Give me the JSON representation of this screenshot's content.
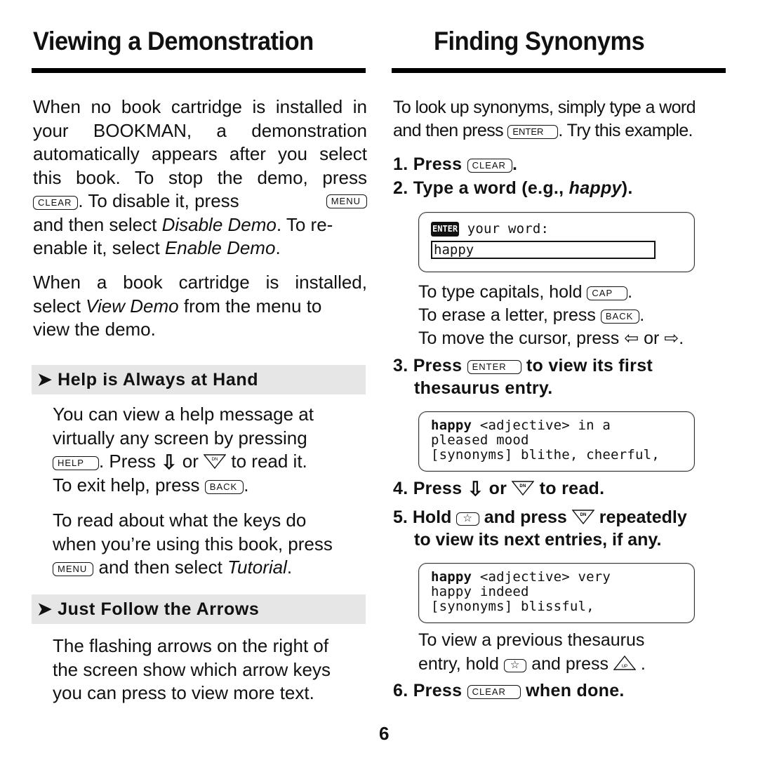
{
  "left": {
    "title": "Viewing a Demonstration",
    "intro": {
      "line1": "When no book cartridge is installed in",
      "line2": "your BOOKMAN, a demonstration",
      "line3": "automatically appears after you select",
      "line4": "this book. To stop the demo, press",
      "key_clear": "CLEAR",
      "line5_mid": ". To disable it, press",
      "key_menu": "MENU",
      "line6_a": "and then select ",
      "line6_i": "Disable Demo",
      "line6_b": ". To re-",
      "line7_a": "enable it, select ",
      "line7_i": "Enable Demo",
      "line7_b": "."
    },
    "cartridge": {
      "line1": "When a book cartridge is installed,",
      "line2_a": "select ",
      "line2_i": "View Demo",
      "line2_b": " from the menu to",
      "line3": "view the demo."
    },
    "help_section": {
      "heading": "➤ Help is Always at Hand",
      "line1": "You can view a help message at",
      "line2": "virtually any screen by pressing",
      "key_help": "HELP",
      "line3_a": ". Press ",
      "line3_or": " or ",
      "dn_label": "DN",
      "line3_b": " to read it.",
      "line4_a": "To exit help, press ",
      "key_back": "BACK",
      "line4_b": ".",
      "keys_line1": "To read about what the keys do",
      "keys_line2": "when you’re using this book, press",
      "key_menu": "MENU",
      "keys_line3_a": " and then select ",
      "keys_line3_i": "Tutorial",
      "keys_line3_b": "."
    },
    "arrows_section": {
      "heading": "➤ Just Follow the Arrows",
      "line1": "The flashing arrows on the right of",
      "line2": "the screen show which arrow keys",
      "line3": "you can press to view more text."
    }
  },
  "right": {
    "title": "Finding Synonyms",
    "intro": {
      "line1": "To look up synonyms, simply type a word",
      "line2_a": "and then press ",
      "key_enter": "ENTER",
      "line2_b": ". Try this example."
    },
    "step1": {
      "num": "1.",
      "text": "Press ",
      "key": "CLEAR",
      "end": "."
    },
    "step2": {
      "num": "2.",
      "text": "Type a word (e.g., ",
      "italic": "happy",
      "end": ")."
    },
    "screen1": {
      "badge": "ENTER",
      "prompt": " your word:",
      "input_value": "happy"
    },
    "tips": {
      "cap_a": "To type capitals, hold ",
      "key_cap": "CAP",
      "cap_b": ".",
      "erase_a": "To erase a letter, press ",
      "key_back": "BACK",
      "erase_b": ".",
      "cursor_a": "To move the cursor, press ",
      "left_arrow": "⇦",
      "or": " or ",
      "right_arrow": "⇨",
      "cursor_b": "."
    },
    "step3": {
      "num": "3.",
      "text": "Press ",
      "key": "ENTER",
      "after": " to view its first",
      "line2": "thesaurus entry."
    },
    "screen2": {
      "word": "happy",
      "line1_rest": " <adjective> in a",
      "line2": "pleased mood",
      "line3": "[synonyms] blithe, cheerful,"
    },
    "step4": {
      "num": "4.",
      "text": "Press ",
      "or": " or ",
      "dn_label": "DN",
      "end": " to read."
    },
    "step5": {
      "num": "5.",
      "text": "Hold ",
      "key_star": "☆",
      "mid": " and press ",
      "dn_label": "DN",
      "end": " repeatedly",
      "line2": "to view its next entries, if any."
    },
    "screen3": {
      "word": "happy",
      "line1_rest": " <adjective> very",
      "line2": "happy indeed",
      "line3": "[synonyms] blissful,"
    },
    "prev": {
      "line1": "To view a previous thesaurus",
      "line2_a": "entry, hold ",
      "key_star": "☆",
      "line2_b": " and press ",
      "up_label": "UP",
      "line2_c": " ."
    },
    "step6": {
      "num": "6.",
      "text": "Press ",
      "key": "CLEAR",
      "end": " when done."
    }
  },
  "page_number": "6"
}
